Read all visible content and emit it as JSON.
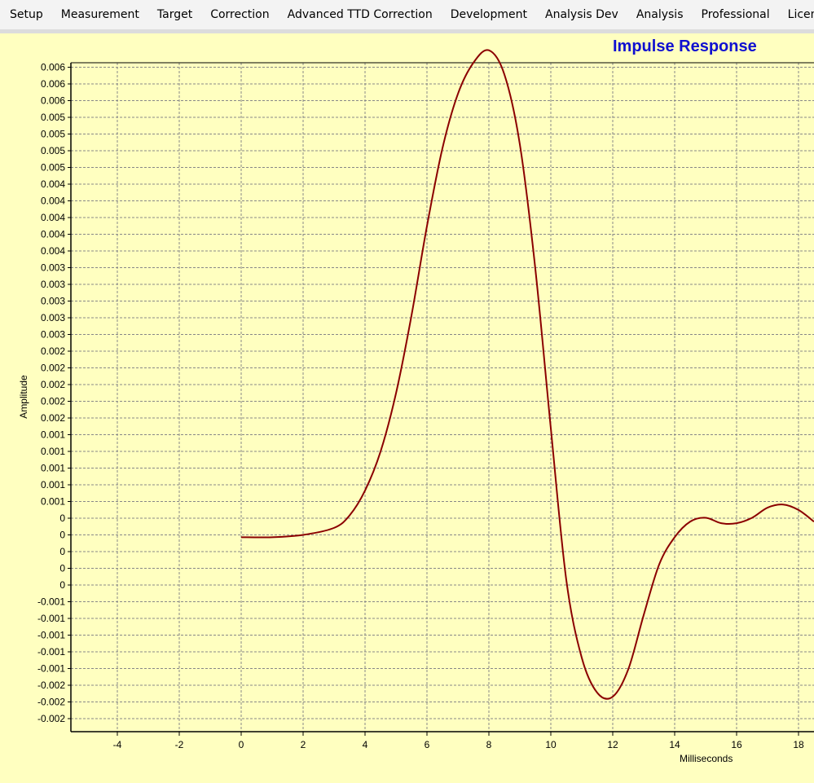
{
  "menu": {
    "items": [
      "Setup",
      "Measurement",
      "Target",
      "Correction",
      "Advanced TTD Correction",
      "Development",
      "Analysis Dev",
      "Analysis",
      "Professional",
      "Licensing"
    ]
  },
  "colors": {
    "plot_background": "#ffffc0",
    "curve": "#8b0000",
    "title": "#1010d0",
    "grid": "#888888"
  },
  "chart_data": {
    "type": "line",
    "title": "Impulse Response",
    "xlabel": "Milliseconds",
    "ylabel": "Amplitude",
    "xlim": [
      -5.5,
      18.5
    ],
    "ylim": [
      -0.0025,
      0.0061
    ],
    "x_ticks": [
      -4,
      -2,
      0,
      2,
      4,
      6,
      8,
      10,
      12,
      14,
      16,
      18
    ],
    "y_tick_labels": [
      "0.006",
      "0.006",
      "0.006",
      "0.005",
      "0.005",
      "0.005",
      "0.005",
      "0.004",
      "0.004",
      "0.004",
      "0.004",
      "0.004",
      "0.003",
      "0.003",
      "0.003",
      "0.003",
      "0.003",
      "0.002",
      "0.002",
      "0.002",
      "0.002",
      "0.002",
      "0.001",
      "0.001",
      "0.001",
      "0.001",
      "0.001",
      "0",
      "0",
      "0",
      "0",
      "0",
      "-0.001",
      "-0.001",
      "-0.001",
      "-0.001",
      "-0.001",
      "-0.002",
      "-0.002",
      "-0.002"
    ],
    "grid": true,
    "series": [
      {
        "color": "#8b0000",
        "x": [
          0,
          1,
          2,
          3,
          3.5,
          4,
          4.5,
          5,
          5.5,
          6,
          6.5,
          7,
          7.5,
          8,
          8.5,
          9,
          9.5,
          10,
          10.5,
          11,
          11.5,
          12,
          12.5,
          13,
          13.5,
          14,
          14.5,
          15,
          15.5,
          16,
          16.5,
          17,
          17.5,
          18,
          18.5
        ],
        "y": [
          0,
          0,
          3e-05,
          0.00012,
          0.00028,
          0.0006,
          0.0011,
          0.00185,
          0.00285,
          0.004,
          0.005,
          0.0057,
          0.0061,
          0.00626,
          0.00595,
          0.00505,
          0.00345,
          0.0014,
          -0.00055,
          -0.00155,
          -0.002,
          -0.00205,
          -0.0017,
          -0.001,
          -0.00035,
          0.0,
          0.0002,
          0.00025,
          0.00018,
          0.00018,
          0.00025,
          0.00038,
          0.00042,
          0.00035,
          0.0002
        ]
      }
    ]
  }
}
